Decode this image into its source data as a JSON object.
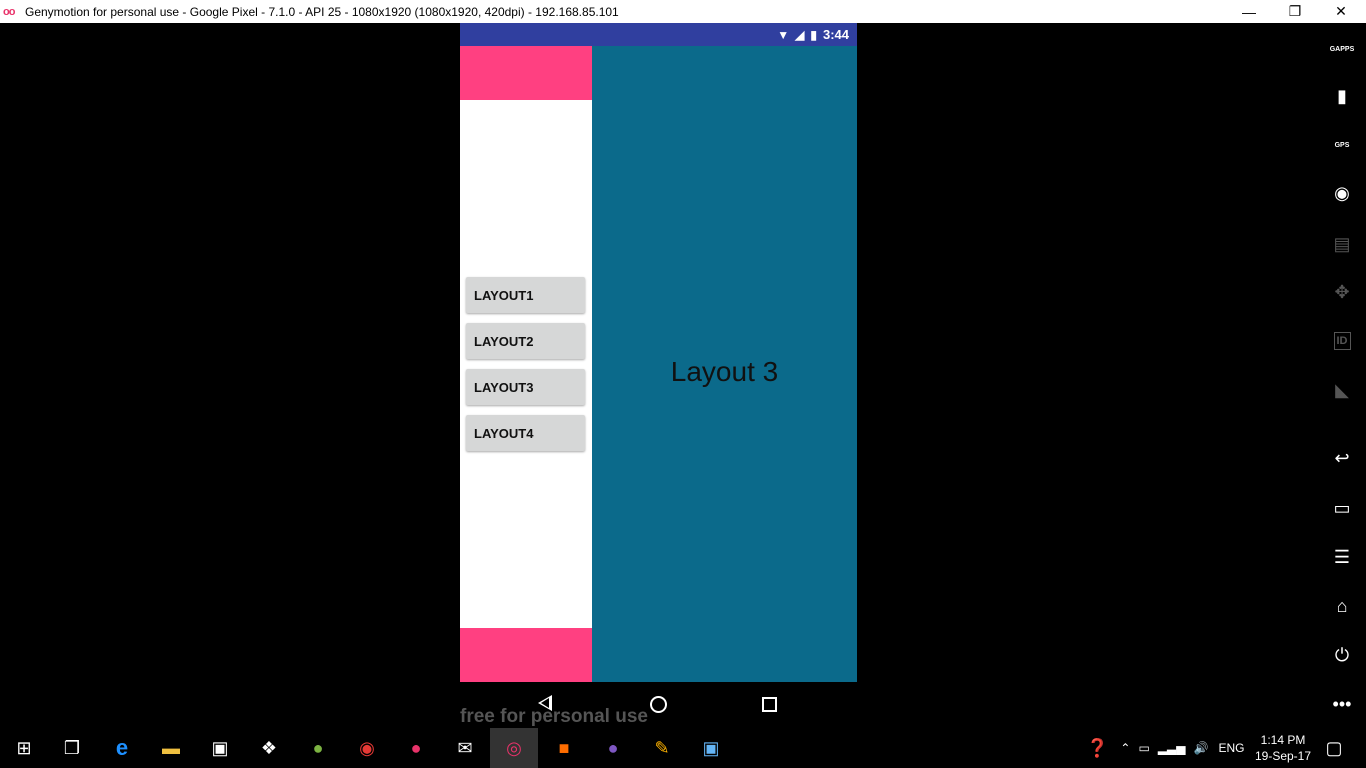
{
  "window": {
    "title": "Genymotion for personal use - Google Pixel - 7.1.0 - API 25 - 1080x1920 (1080x1920, 420dpi) - 192.168.85.101",
    "logo_text": "oo",
    "minimize": "—",
    "restore": "❐",
    "close": "✕"
  },
  "android": {
    "status_time": "3:44",
    "buttons": [
      "LAYOUT1",
      "LAYOUT2",
      "LAYOUT3",
      "LAYOUT4"
    ],
    "content_label": "Layout 3",
    "watermark": "free for personal use",
    "colors": {
      "status": "#303f9f",
      "accent": "#ff4081",
      "content": "#0b6a8b"
    }
  },
  "right_toolbar": {
    "gapps_label": "GAPPS",
    "gps_label": "GPS",
    "id_label": "ID",
    "items": [
      "gapps-icon",
      "battery-icon",
      "gps-icon",
      "camera-icon",
      "capture-icon",
      "dpad-icon",
      "id-icon",
      "cast-icon",
      "back-icon",
      "recent-apps-icon",
      "menu-icon",
      "home-icon",
      "power-icon",
      "more-icon"
    ]
  },
  "taskbar": {
    "language": "ENG",
    "time": "1:14 PM",
    "date": "19-Sep-17"
  }
}
